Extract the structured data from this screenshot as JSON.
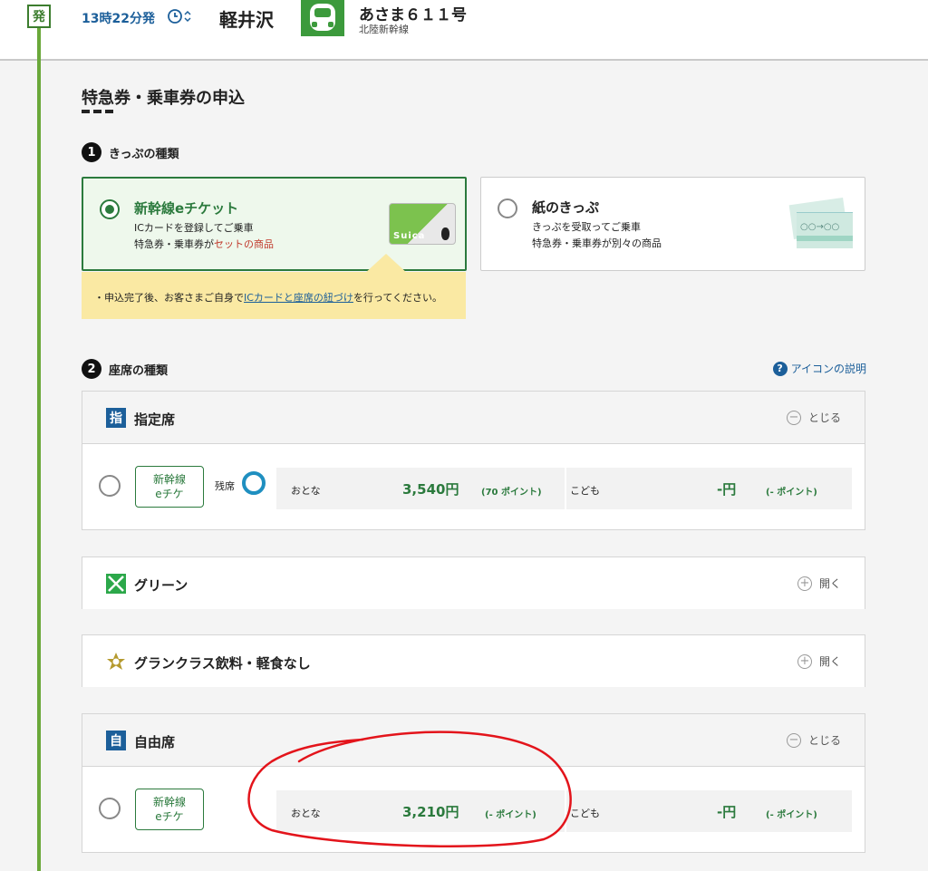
{
  "header": {
    "dep_badge": "発",
    "departure_time": "13時22分発",
    "station": "軽井沢",
    "train_name": "あさま６１１号",
    "train_line": "北陸新幹線"
  },
  "page": {
    "title": "特急券・乗車券の申込"
  },
  "section1": {
    "number": "1",
    "heading": "きっぷの種類",
    "options": [
      {
        "title": "新幹線eチケット",
        "line1": "ICカードを登録してご乗車",
        "line2_a": "特急券・乗車券が",
        "line2_b": "セットの商品",
        "card_text": "Suica",
        "selected": true
      },
      {
        "title": "紙のきっぷ",
        "line1": "きっぷを受取ってご乗車",
        "line2": "特急券・乗車券が別々の商品",
        "ticket_text": "○○→○○",
        "selected": false
      }
    ],
    "notice_a": "・申込完了後、お客さまご自身で",
    "notice_link": "ICカードと座席の紐づけ",
    "notice_b": "を行ってください。"
  },
  "section2": {
    "number": "2",
    "heading": "座席の種類",
    "help_label": "アイコンの説明",
    "help_icon": "?",
    "reserved": {
      "icon_char": "指",
      "name": "指定席",
      "toggle_label": "とじる",
      "toggle_symbol": "−",
      "eticket_l1": "新幹線",
      "eticket_l2": "eチケ",
      "remaining_label": "残席",
      "adult_label": "おとな",
      "adult_price": "3,540円",
      "adult_points": "(70 ポイント)",
      "child_label": "こども",
      "child_price": "-円",
      "child_points": "(- ポイント)"
    },
    "green": {
      "name": "グリーン",
      "toggle_label": "開く",
      "toggle_symbol": "+"
    },
    "gran": {
      "name": "グランクラス飲料・軽食なし",
      "toggle_label": "開く",
      "toggle_symbol": "+"
    },
    "nonreserved": {
      "icon_char": "自",
      "name": "自由席",
      "toggle_label": "とじる",
      "toggle_symbol": "−",
      "eticket_l1": "新幹線",
      "eticket_l2": "eチケ",
      "adult_label": "おとな",
      "adult_price": "3,210円",
      "adult_points": "(- ポイント)",
      "child_label": "こども",
      "child_price": "-円",
      "child_points": "(- ポイント)"
    }
  },
  "colors": {
    "accent_green": "#2b7a3d",
    "link_blue": "#1c5f9a",
    "notice_yellow": "#fae9a3",
    "annotation_red": "#e3141b"
  }
}
